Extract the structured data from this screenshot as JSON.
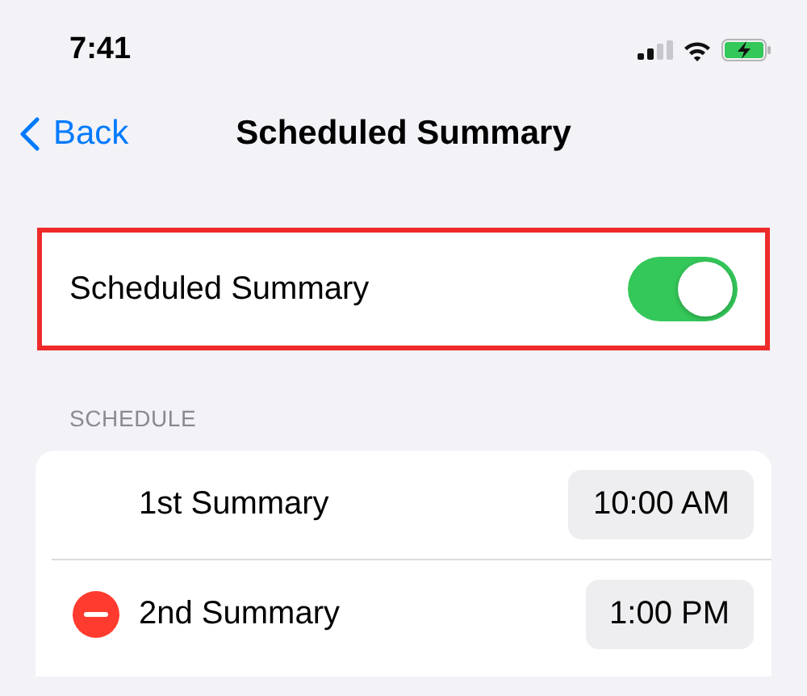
{
  "status_bar": {
    "time": "7:41"
  },
  "nav": {
    "back": "Back",
    "title": "Scheduled Summary"
  },
  "setting": {
    "label": "Scheduled Summary",
    "on": true
  },
  "schedule": {
    "header": "SCHEDULE",
    "rows": [
      {
        "label": "1st Summary",
        "time": "10:00 AM",
        "deletable": false
      },
      {
        "label": "2nd Summary",
        "time": "1:00 PM",
        "deletable": true
      }
    ]
  }
}
